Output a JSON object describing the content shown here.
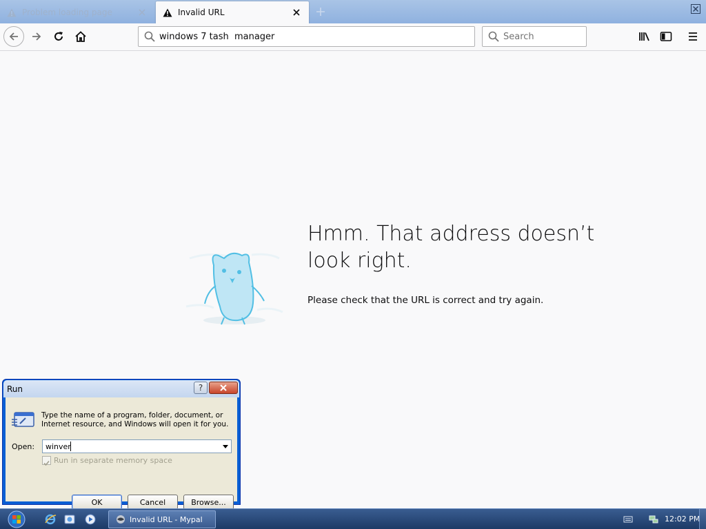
{
  "tabs": [
    {
      "title": "Problem loading page",
      "active": false,
      "icon": "warning-icon"
    },
    {
      "title": "Invalid URL",
      "active": true,
      "icon": "warning-icon"
    }
  ],
  "navbar": {
    "url_value": "windows 7 tash  manager",
    "search_placeholder": "Search"
  },
  "error_page": {
    "title": "Hmm. That address doesn’t look right.",
    "description": "Please check that the URL is correct and try again."
  },
  "run_dialog": {
    "title": "Run",
    "help_label": "?",
    "description": "Type the name of a program, folder, document, or Internet resource, and Windows will open it for you.",
    "open_label": "Open:",
    "open_value": "winver",
    "checkbox_label": "Run in separate memory space",
    "checkbox_checked": true,
    "buttons": {
      "ok": "OK",
      "cancel": "Cancel",
      "browse": "Browse..."
    }
  },
  "taskbar": {
    "task_button_label": "Invalid URL - Mypal",
    "clock": "12:02 PM"
  },
  "colors": {
    "page_bg": "#f9f9fa",
    "tabstrip": "#a9c4e6",
    "taskbar": "#1d3a66",
    "dialog_frame": "#0a5fd4"
  }
}
